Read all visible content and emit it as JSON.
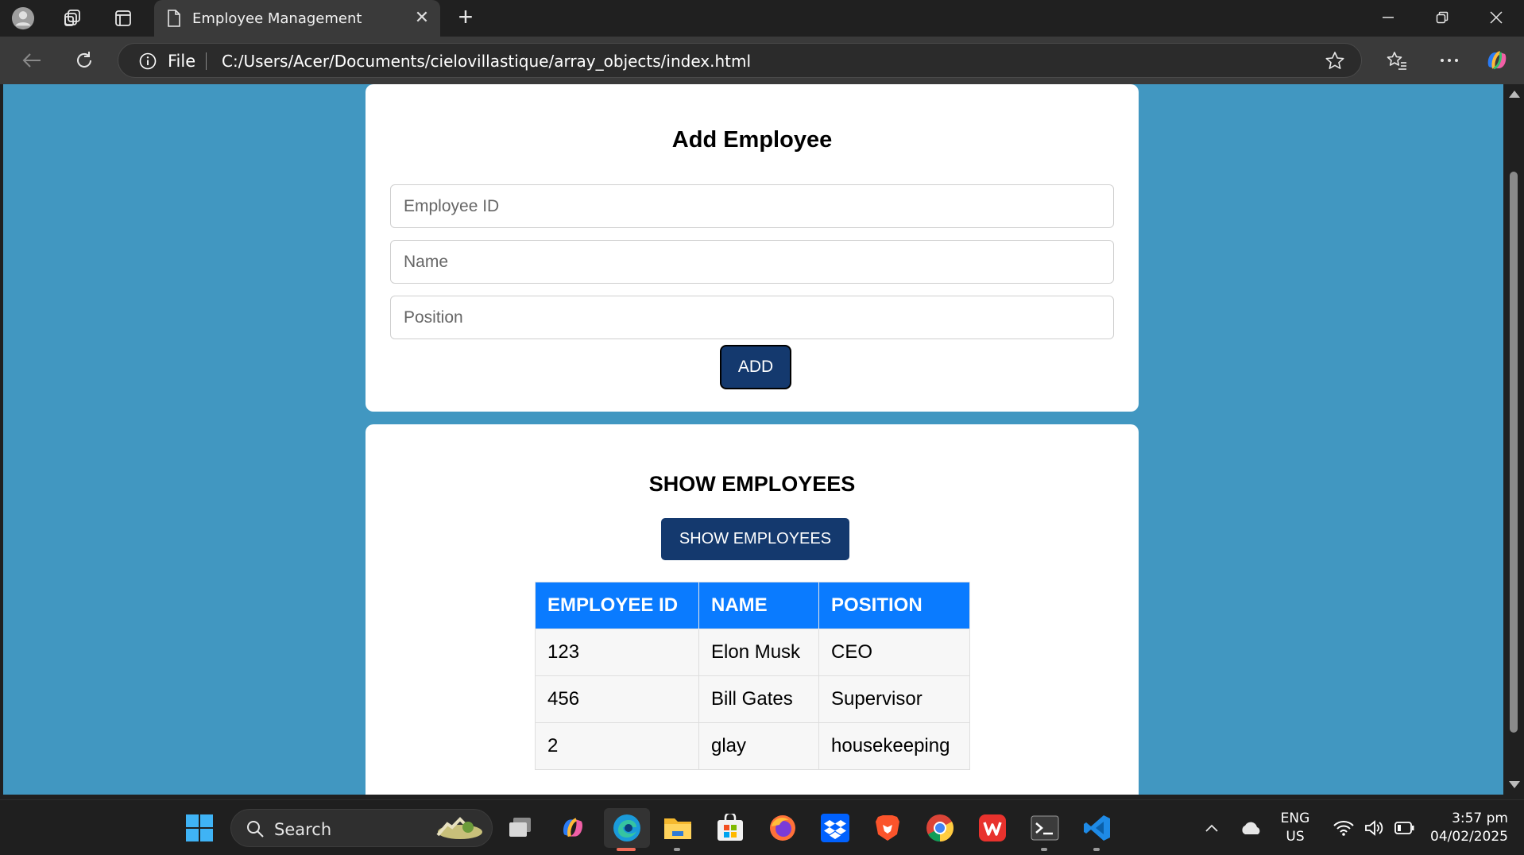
{
  "browser": {
    "tab_title": "Employee Management",
    "address_scheme": "File",
    "address_url": "C:/Users/Acer/Documents/cielovillastique/array_objects/index.html"
  },
  "add_form": {
    "title": "Add Employee",
    "employee_id_placeholder": "Employee ID",
    "name_placeholder": "Name",
    "position_placeholder": "Position",
    "add_button": "ADD"
  },
  "show_section": {
    "title": "SHOW EMPLOYEES",
    "button": "SHOW EMPLOYEES",
    "table": {
      "headers": [
        "EMPLOYEE ID",
        "NAME",
        "POSITION"
      ],
      "rows": [
        [
          "123",
          "Elon Musk",
          "CEO"
        ],
        [
          "456",
          "Bill Gates",
          "Supervisor"
        ],
        [
          "2",
          "glay",
          "housekeeping"
        ]
      ]
    }
  },
  "taskbar": {
    "search_label": "Search",
    "language_top": "ENG",
    "language_bottom": "US",
    "time": "3:57 pm",
    "date": "04/02/2025"
  },
  "colors": {
    "page_bg": "#4197c1",
    "button_bg": "#14396e",
    "table_header_bg": "#0a7bff"
  }
}
